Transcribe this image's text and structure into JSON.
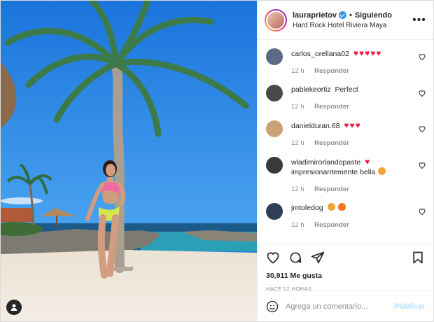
{
  "post": {
    "username": "lauraprietov",
    "separator": "•",
    "follow_status": "Siguiendo",
    "location": "Hard Rock Hotel Riviera Maya"
  },
  "comments": [
    {
      "user": "carlos_orellana02",
      "text": "",
      "hearts": "♥♥♥♥♥",
      "time": "12 h",
      "reply": "Responder",
      "avatar_color": "#5b6b86"
    },
    {
      "user": "pablekeortiz",
      "text": "Perfect",
      "hearts": "",
      "time": "12 h",
      "reply": "Responder",
      "avatar_color": "#4a4a4a"
    },
    {
      "user": "danielduran.68",
      "text": "",
      "hearts": "♥♥♥",
      "time": "12 h",
      "reply": "Responder",
      "avatar_color": "#c9a27a"
    },
    {
      "user": "wladimirorlandopaste",
      "text": "impresionantemente bella",
      "hearts": "♥",
      "time": "12 h",
      "reply": "Responder",
      "avatar_color": "#3a3a3a"
    },
    {
      "user": "jmtoledog",
      "text": "",
      "hearts": "",
      "time": "12 h",
      "reply": "Responder",
      "avatar_color": "#2f3d55"
    }
  ],
  "footer": {
    "likes": "30,911 Me gusta",
    "time_ago": "HACE 12 HORAS",
    "comment_placeholder": "Agrega un comentario...",
    "publish_label": "Publicar"
  },
  "colors": {
    "sky": "#1f7de0",
    "heart": "#ed1c45",
    "link_disabled": "#b2dffc",
    "verified": "#3897f0"
  }
}
